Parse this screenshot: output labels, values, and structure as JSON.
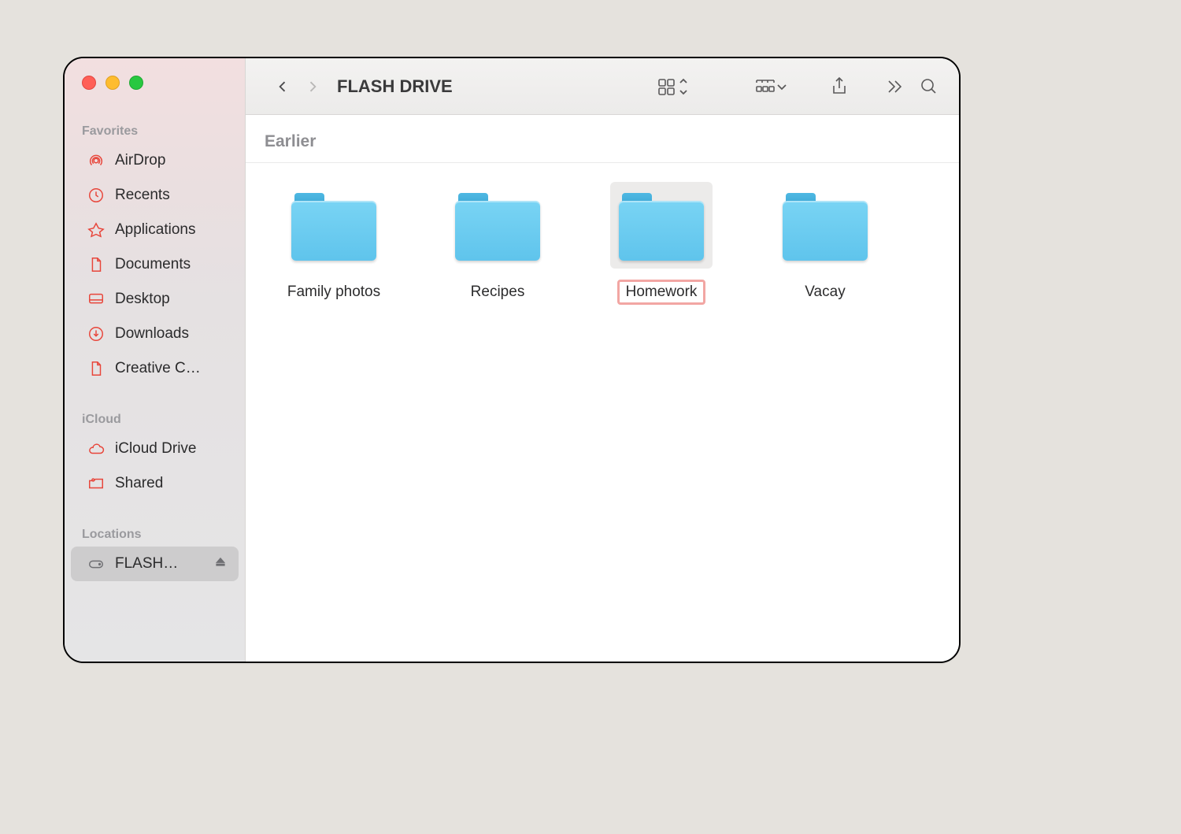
{
  "window_title": "FLASH DRIVE",
  "sidebar": {
    "favorites_label": "Favorites",
    "favorites": [
      {
        "label": "AirDrop"
      },
      {
        "label": "Recents"
      },
      {
        "label": "Applications"
      },
      {
        "label": "Documents"
      },
      {
        "label": "Desktop"
      },
      {
        "label": "Downloads"
      },
      {
        "label": "Creative C…"
      }
    ],
    "icloud_label": "iCloud",
    "icloud": [
      {
        "label": "iCloud Drive"
      },
      {
        "label": "Shared"
      }
    ],
    "locations_label": "Locations",
    "locations": [
      {
        "label": "FLASH…",
        "selected": true
      }
    ]
  },
  "content": {
    "group_header": "Earlier",
    "items": [
      {
        "label": "Family photos",
        "selected": false
      },
      {
        "label": "Recipes",
        "selected": false
      },
      {
        "label": "Homework",
        "selected": true
      },
      {
        "label": "Vacay",
        "selected": false
      }
    ]
  }
}
